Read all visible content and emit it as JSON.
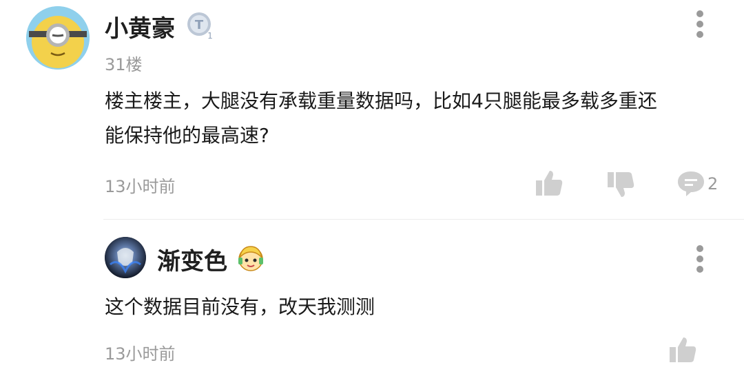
{
  "comment": {
    "username": "小黄豪",
    "badge_text": "T",
    "badge_level": "1",
    "floor": "31楼",
    "text_line1": "楼主楼主，大腿没有承载重量数据吗，比如4只腿能最多载多重还",
    "text_line2": "能保持他的最高速?",
    "time": "13小时前",
    "reply_count": "2",
    "colors": {
      "badge": "#a9b6c9",
      "avatar_bg": "#e8c84a",
      "avatar_ring": "#8fd0ec"
    }
  },
  "reply": {
    "username": "渐变色",
    "text": "这个数据目前没有，改天我测测",
    "time": "13小时前"
  },
  "icons": {
    "like": "thumbs-up-icon",
    "dislike": "thumbs-down-icon",
    "comment": "comment-bubble-icon",
    "more": "more-vertical-icon"
  }
}
